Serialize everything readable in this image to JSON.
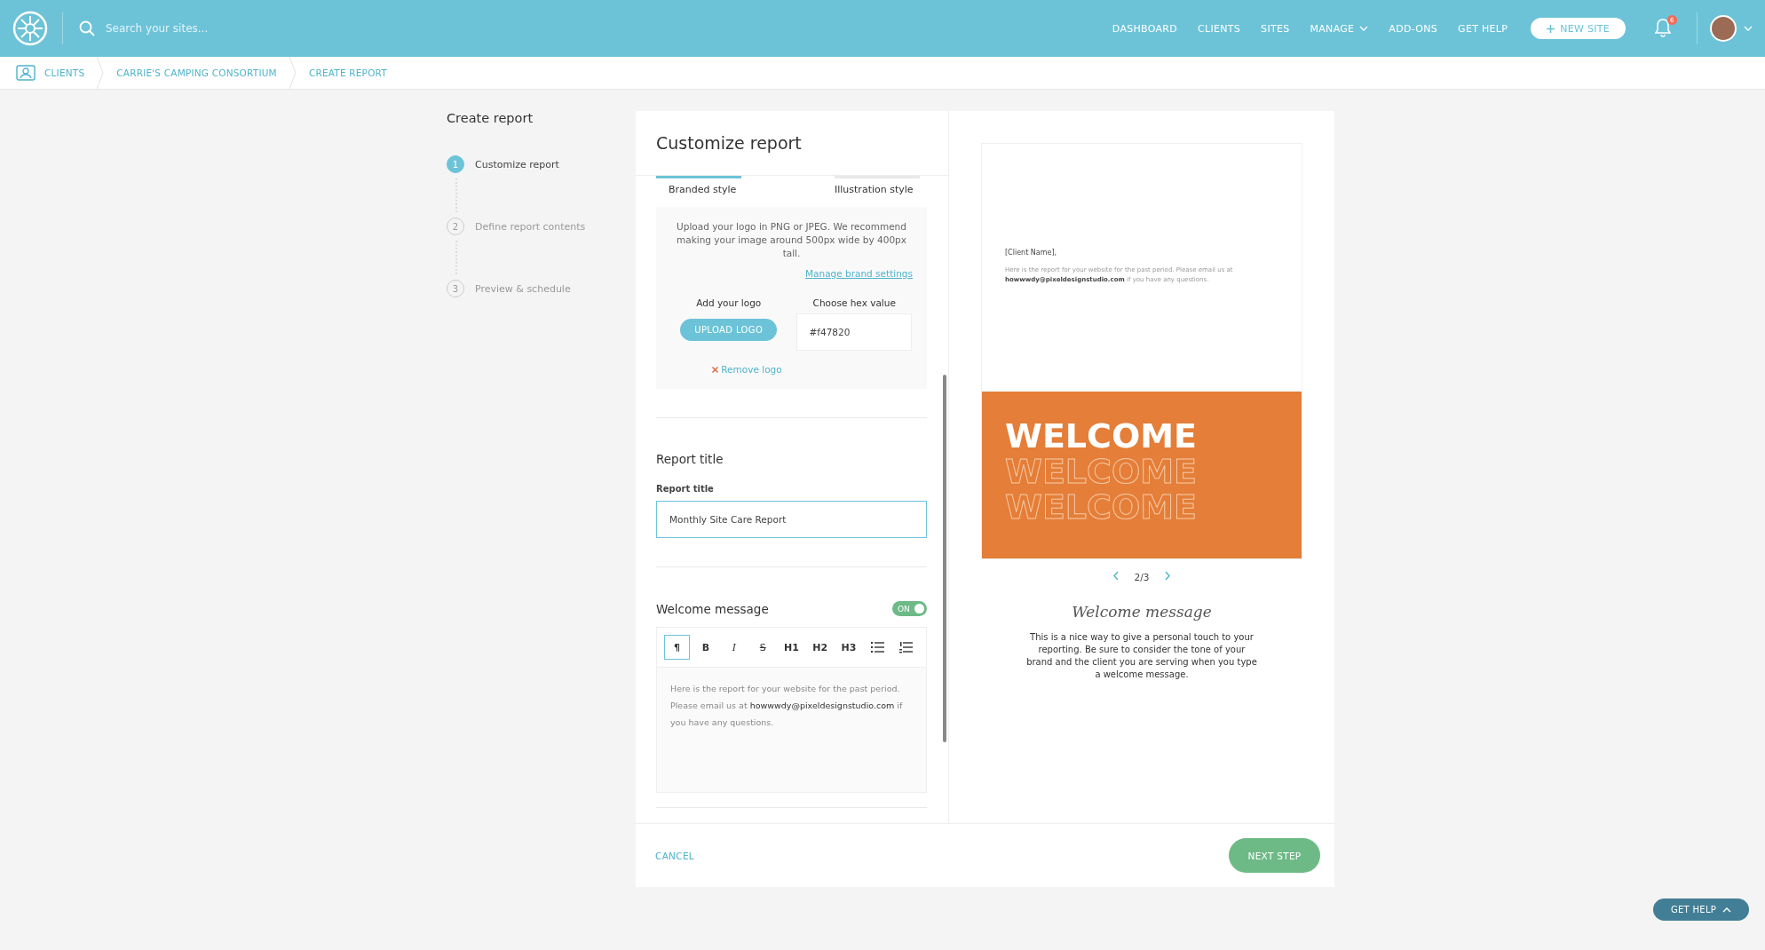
{
  "header": {
    "search": {
      "placeholder": "Search your sites..."
    },
    "nav": [
      {
        "label": "DASHBOARD",
        "has_caret": false
      },
      {
        "label": "CLIENTS",
        "has_caret": false
      },
      {
        "label": "SITES",
        "has_caret": false
      },
      {
        "label": "MANAGE",
        "has_caret": true
      },
      {
        "label": "ADD-ONS",
        "has_caret": false
      },
      {
        "label": "GET HELP",
        "has_caret": false
      }
    ],
    "new_site_button": "NEW SITE",
    "notification_count": "6"
  },
  "breadcrumb": [
    "CLIENTS",
    "CARRIE'S CAMPING CONSORTIUM",
    "CREATE REPORT"
  ],
  "sidebar": {
    "title": "Create report",
    "steps": [
      {
        "number": "1",
        "label": "Customize report",
        "selected": true
      },
      {
        "number": "2",
        "label": "Define report contents",
        "selected": false
      },
      {
        "number": "3",
        "label": "Preview & schedule",
        "selected": false
      }
    ]
  },
  "form": {
    "title": "Customize report",
    "style_tabs": [
      {
        "label": "Branded style",
        "selected": true
      },
      {
        "label": "Illustration style",
        "selected": false
      }
    ],
    "logo_panel": {
      "instructions": "Upload your logo in PNG or JPEG. We recommend making your image around 500px wide by 400px tall.",
      "manage_link": "Manage brand settings",
      "add_logo_label": "Add your logo",
      "upload_button": "UPLOAD LOGO",
      "hex_label": "Choose hex value",
      "hex_value": "#f47820",
      "remove_link": "Remove logo"
    },
    "report_title": {
      "heading": "Report title",
      "label": "Report title",
      "value": "Monthly Site Care Report"
    },
    "welcome": {
      "heading": "Welcome message",
      "toggle": {
        "label": "ON",
        "on": true
      },
      "toolbar": [
        {
          "kind": "text",
          "label": "¶",
          "selected": true
        },
        {
          "kind": "bold",
          "label": "B",
          "selected": false
        },
        {
          "kind": "italic",
          "label": "I",
          "selected": false
        },
        {
          "kind": "strike",
          "label": "S",
          "selected": false
        },
        {
          "kind": "text",
          "label": "H1",
          "selected": false
        },
        {
          "kind": "text",
          "label": "H2",
          "selected": false
        },
        {
          "kind": "text",
          "label": "H3",
          "selected": false
        },
        {
          "kind": "bullet-list",
          "selected": false
        },
        {
          "kind": "numbered-list",
          "selected": false
        }
      ],
      "text": "Here is the report for your website for the past period. Please email us at **howwwdy@pixeldesignstudio.com** if you have any questions."
    }
  },
  "preview": {
    "client_name": "[Client Name],",
    "body": "Here is the report for your website for the past period. Please email us at **howwwdy@pixeldesignstudio.com** if you have any questions.",
    "banner_lines": [
      {
        "text": "WELCOME",
        "kind": "filled"
      },
      {
        "text": "WELCOME",
        "kind": "outline"
      },
      {
        "text": "WELCOME",
        "kind": "outline"
      }
    ],
    "pager": "2/3",
    "heading": "Welcome message",
    "description": "This is a nice way to give a personal touch to your reporting. Be sure to consider the tone of your brand and the client you are serving when you type a welcome message."
  },
  "footer": {
    "cancel": "CANCEL",
    "next": "NEXT STEP"
  },
  "help_button": "GET HELP"
}
